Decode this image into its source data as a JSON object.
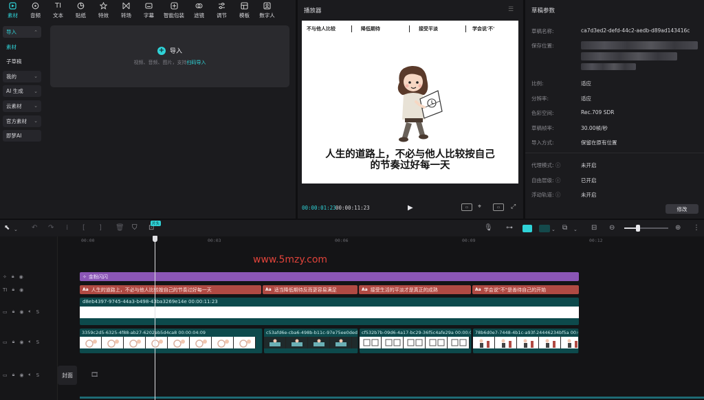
{
  "toolbar": {
    "items": [
      {
        "label": "素材",
        "icon": "media-icon"
      },
      {
        "label": "音频",
        "icon": "audio-icon"
      },
      {
        "label": "文本",
        "icon": "text-icon"
      },
      {
        "label": "贴纸",
        "icon": "sticker-icon"
      },
      {
        "label": "特效",
        "icon": "effects-icon"
      },
      {
        "label": "转场",
        "icon": "transition-icon"
      },
      {
        "label": "字幕",
        "icon": "captions-icon"
      },
      {
        "label": "智能包装",
        "icon": "smart-pack-icon"
      },
      {
        "label": "滤镜",
        "icon": "filter-icon"
      },
      {
        "label": "调节",
        "icon": "adjust-icon"
      },
      {
        "label": "模板",
        "icon": "template-icon"
      },
      {
        "label": "数字人",
        "icon": "avatar-icon"
      }
    ]
  },
  "leftnav": {
    "items": [
      "导入",
      "素材",
      "子草稿",
      "我的",
      "AI 生成",
      "云素材",
      "官方素材",
      "即梦AI"
    ]
  },
  "import": {
    "button": "导入",
    "hint": "视频、音频、图片，支持",
    "hint_link": "扫码导入"
  },
  "player": {
    "title": "播放器",
    "chapters": [
      "不与他人比较",
      "降低期待",
      "接受平淡",
      "学会说'不'"
    ],
    "subtitle_line1": "人生的道路上，不必与他人比较按自己",
    "subtitle_line2": "的节奏过好每一天",
    "time_current": "00:00:01:23",
    "time_total": "00:00:11:23"
  },
  "props": {
    "title": "草稿参数",
    "name_label": "草稿名称:",
    "name_value": "ca7d3ed2-defd-44c2-aedb-d89ad143416c",
    "path_label": "保存位置:",
    "ratio_label": "比例:",
    "ratio_value": "适应",
    "res_label": "分辨率:",
    "res_value": "适应",
    "color_label": "色彩空间:",
    "color_value": "Rec.709 SDR",
    "fps_label": "草稿帧率:",
    "fps_value": "30.00帧/秒",
    "import_label": "导入方式:",
    "import_value": "保留在原有位置",
    "proxy_label": "代理模式:",
    "proxy_value": "未开启",
    "free_label": "自由层级:",
    "free_value": "已开启",
    "snap_label": "浮动轨道:",
    "snap_value": "未开启",
    "modify_button": "修改"
  },
  "timeline": {
    "ruler": [
      "00:00",
      "00:03",
      "00:06",
      "00:09",
      "00:12"
    ],
    "playhead_badge": "片头",
    "effect_clip": "金粉闪闪",
    "text_tag": "Aa",
    "text_clips": [
      "人生的道路上，不必与他人比较按自己的节奏过好每一天",
      "适当降低期待反而更容易满足",
      "接受生活的平淡才是真正的成熟",
      "学会说\"不\"是善待自己的开始"
    ],
    "audio_clip_label": "d8eb4397-9745-44a3-b498-43ba3269e14e   00:00:11:23",
    "video_clips": [
      "3359c2d5-6325-4f88-ab27-6202eb5d4ca8   00:00:04:09",
      "c53afd6e-cba6-498b-b11c-97e75ee0ded6",
      "cf532b7b-09d6-4a17-bc29-36f5c4afe29a   00:00:02",
      "78b6d0e7-7448-4b1c-a93f-24446234bf5a   00:0"
    ],
    "cover_label": "封面",
    "watermark": "www.5mzy.com"
  },
  "colors": {
    "accent": "#2fd3d8",
    "text_clip": "#b04a43",
    "effect_clip": "#8b56b5",
    "video_clip": "#0d4a4c"
  }
}
